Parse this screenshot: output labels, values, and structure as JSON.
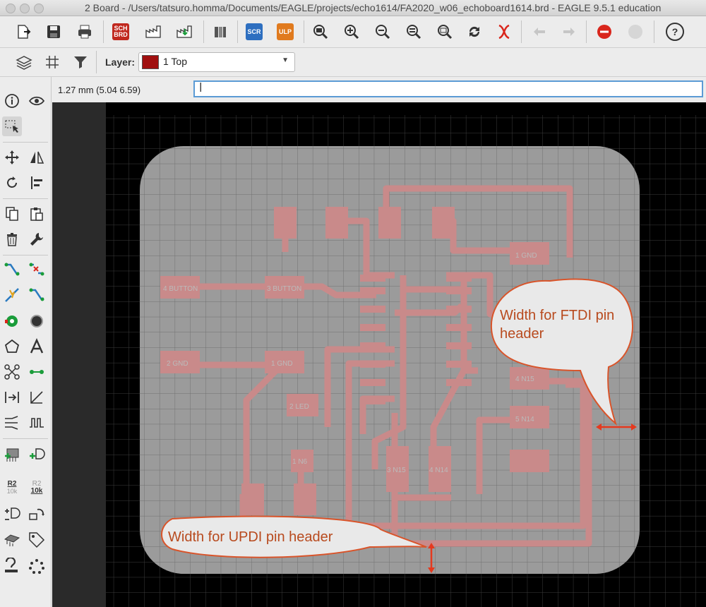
{
  "window": {
    "title": "2 Board - /Users/tatsuro.homma/Documents/EAGLE/projects/echo1614/FA2020_w06_echoboard1614.brd - EAGLE 9.5.1 education"
  },
  "toolbar": {
    "sch_brd_label_top": "SCH",
    "sch_brd_label_bottom": "BRD",
    "scr_label": "SCR",
    "ulp_label": "ULP",
    "help_label": "?"
  },
  "layer_bar": {
    "layer_label": "Layer:",
    "selected_layer": "1 Top",
    "layer_color": "#a00f0f"
  },
  "status": {
    "coordinates": "1.27 mm (5.04 6.59)",
    "command_value": "|"
  },
  "left_tools": {
    "value_top": "R2",
    "value_bottom": "10k",
    "value2_top": "R2",
    "value2_bottom": "10k"
  },
  "board": {
    "pads": [
      {
        "label": "4 BUTTON"
      },
      {
        "label": "3 BUTTON"
      },
      {
        "label": "2 GND"
      },
      {
        "label": "1 GND"
      },
      {
        "label": "1 GND"
      },
      {
        "label": "4 N15"
      },
      {
        "label": "5 N14"
      },
      {
        "label": "2 LED"
      },
      {
        "label": "1 N6"
      },
      {
        "label": "3 N15"
      },
      {
        "label": "4 N14"
      }
    ]
  },
  "callouts": {
    "ftdi_line1": "Width for FTDI pin",
    "ftdi_line2": "header",
    "updi": "Width for UPDI pin header"
  },
  "colors": {
    "board": "#9b9b9b",
    "copper": "#c98a8a",
    "callout_fill": "#e9e9e9",
    "callout_stroke": "#d9542a",
    "arrow": "#e5391e"
  }
}
